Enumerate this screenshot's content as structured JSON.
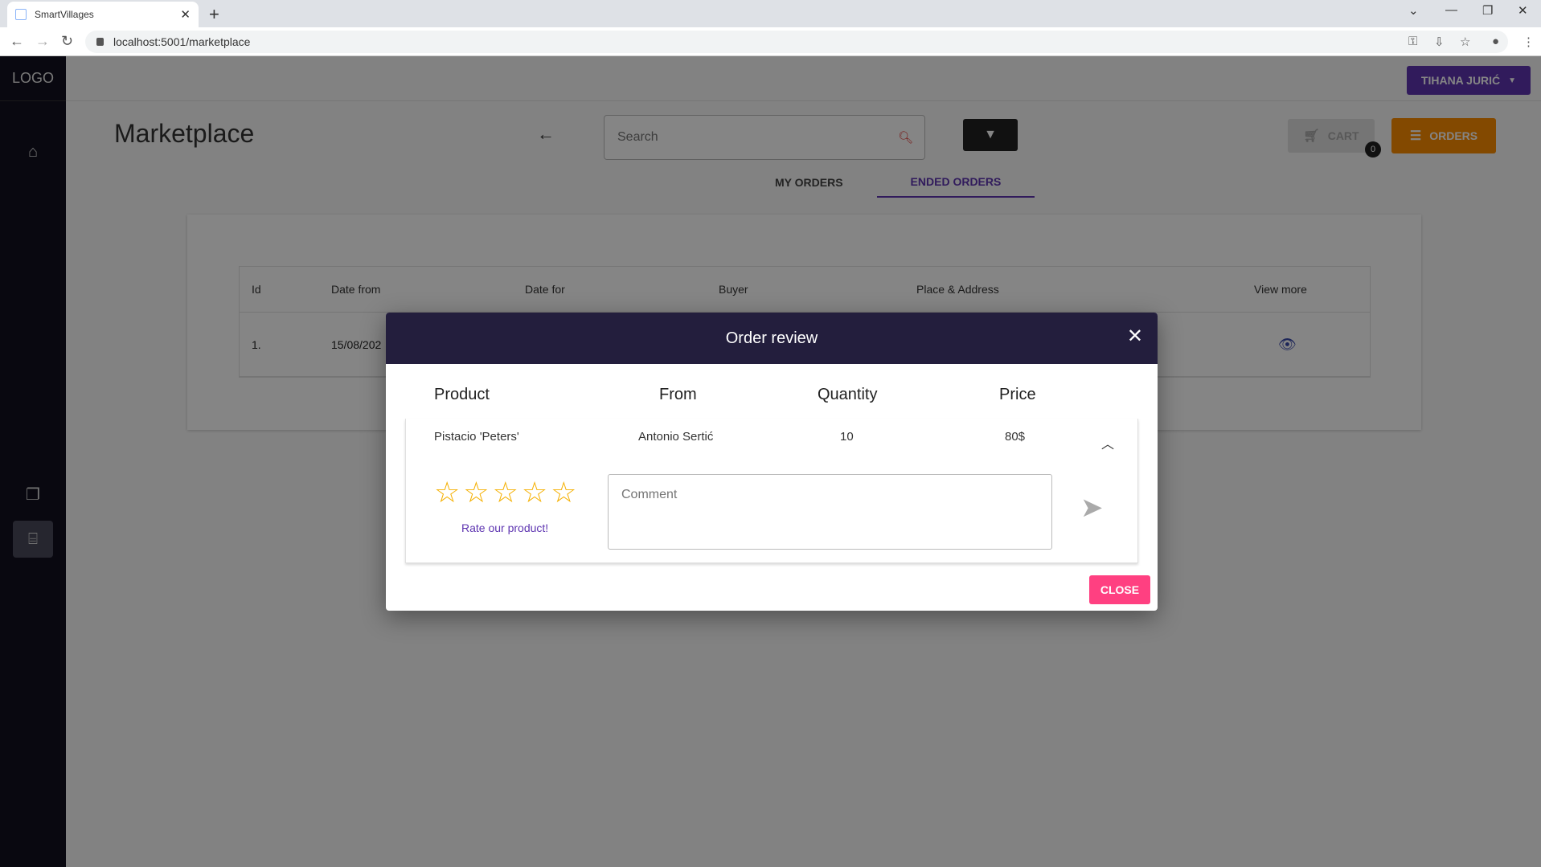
{
  "browser": {
    "tab_title": "SmartVillages",
    "url": "localhost:5001/marketplace"
  },
  "sidebar": {
    "logo": "LOGO",
    "items": [
      {
        "icon": "home-icon"
      },
      {
        "icon": "forum-icon"
      },
      {
        "icon": "store-icon",
        "active": true
      }
    ]
  },
  "header": {
    "user_name": "TIHANA JURIĆ"
  },
  "page": {
    "title": "Marketplace",
    "search_placeholder": "Search",
    "cart_label": "CART",
    "cart_count": "0",
    "orders_label": "ORDERS",
    "tabs": [
      {
        "label": "MY ORDERS",
        "active": false
      },
      {
        "label": "ENDED ORDERS",
        "active": true
      }
    ]
  },
  "orders_table": {
    "columns": [
      "Id",
      "Date from",
      "Date for",
      "Buyer",
      "Place & Address",
      "View more"
    ],
    "rows": [
      {
        "id": "1.",
        "date_from": "15/08/202"
      }
    ]
  },
  "modal": {
    "title": "Order review",
    "columns": [
      "Product",
      "From",
      "Quantity",
      "Price"
    ],
    "item": {
      "product": "Pistacio 'Peters'",
      "from": "Antonio Sertić",
      "quantity": "10",
      "price": "80$"
    },
    "rating": 0,
    "rating_max": 5,
    "rate_prompt": "Rate our product!",
    "comment_placeholder": "Comment",
    "close_label": "CLOSE"
  },
  "colors": {
    "sidebar": "#13111f",
    "accent": "#5e35b1",
    "orders": "#fb8c00",
    "close": "#ff4081",
    "modal_header": "#231e3d",
    "star": "#f5b000"
  }
}
